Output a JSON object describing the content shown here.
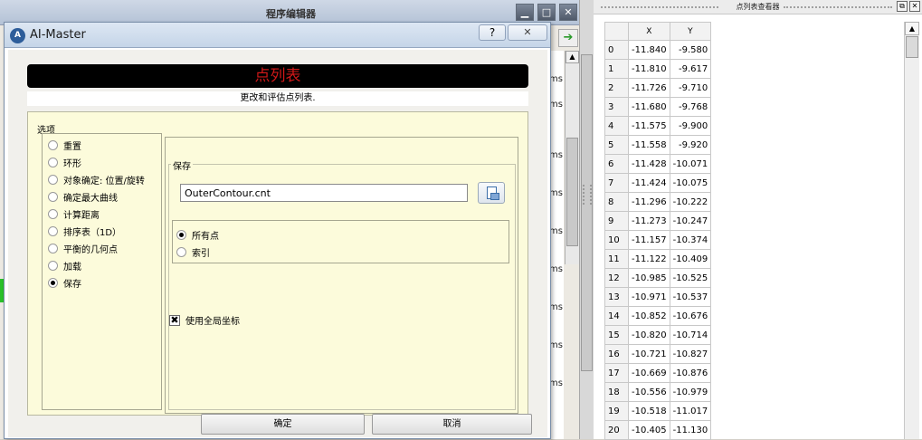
{
  "background_window": {
    "title": "程序编辑器",
    "min_icon": "minimize-icon",
    "max_icon": "maximize-icon",
    "close_icon": "close-icon",
    "ms_labels": [
      "ms",
      "ms",
      "ms",
      "ms",
      "ms",
      "ms",
      "ms",
      "ms",
      "ms"
    ]
  },
  "dialog": {
    "app_name": "AI-Master",
    "help_label": "?",
    "close_label": "✕",
    "banner_title": "点列表",
    "subtitle": "更改和评估点列表.",
    "options_legend": "选项",
    "options": [
      {
        "label": "重置",
        "selected": false
      },
      {
        "label": "环形",
        "selected": false
      },
      {
        "label": "对象确定: 位置/旋转",
        "selected": false
      },
      {
        "label": "确定最大曲线",
        "selected": false
      },
      {
        "label": "计算距离",
        "selected": false
      },
      {
        "label": "排序表（1D）",
        "selected": false
      },
      {
        "label": "平衡的几何点",
        "selected": false
      },
      {
        "label": "加载",
        "selected": false
      },
      {
        "label": "保存",
        "selected": true
      }
    ],
    "save": {
      "legend": "保存",
      "filename": "OuterContour.cnt",
      "point_options": [
        {
          "label": "所有点",
          "selected": true
        },
        {
          "label": "索引",
          "selected": false
        }
      ],
      "use_global_coords_label": "使用全局坐标",
      "use_global_coords_checked": true
    },
    "ok_label": "确定",
    "cancel_label": "取消"
  },
  "viewer": {
    "title": "点列表查看器",
    "columns": [
      "X",
      "Y"
    ],
    "rows": [
      {
        "index": "0",
        "x": "-11.840",
        "y": "-9.580"
      },
      {
        "index": "1",
        "x": "-11.810",
        "y": "-9.617"
      },
      {
        "index": "2",
        "x": "-11.726",
        "y": "-9.710"
      },
      {
        "index": "3",
        "x": "-11.680",
        "y": "-9.768"
      },
      {
        "index": "4",
        "x": "-11.575",
        "y": "-9.900"
      },
      {
        "index": "5",
        "x": "-11.558",
        "y": "-9.920"
      },
      {
        "index": "6",
        "x": "-11.428",
        "y": "-10.071"
      },
      {
        "index": "7",
        "x": "-11.424",
        "y": "-10.075"
      },
      {
        "index": "8",
        "x": "-11.296",
        "y": "-10.222"
      },
      {
        "index": "9",
        "x": "-11.273",
        "y": "-10.247"
      },
      {
        "index": "10",
        "x": "-11.157",
        "y": "-10.374"
      },
      {
        "index": "11",
        "x": "-11.122",
        "y": "-10.409"
      },
      {
        "index": "12",
        "x": "-10.985",
        "y": "-10.525"
      },
      {
        "index": "13",
        "x": "-10.971",
        "y": "-10.537"
      },
      {
        "index": "14",
        "x": "-10.852",
        "y": "-10.676"
      },
      {
        "index": "15",
        "x": "-10.820",
        "y": "-10.714"
      },
      {
        "index": "16",
        "x": "-10.721",
        "y": "-10.827"
      },
      {
        "index": "17",
        "x": "-10.669",
        "y": "-10.876"
      },
      {
        "index": "18",
        "x": "-10.556",
        "y": "-10.979"
      },
      {
        "index": "19",
        "x": "-10.518",
        "y": "-11.017"
      },
      {
        "index": "20",
        "x": "-10.405",
        "y": "-11.130"
      }
    ]
  },
  "colors": {
    "banner_text": "#d01818",
    "options_background": "#fcfbdb",
    "accent_green": "#2ac02a"
  }
}
